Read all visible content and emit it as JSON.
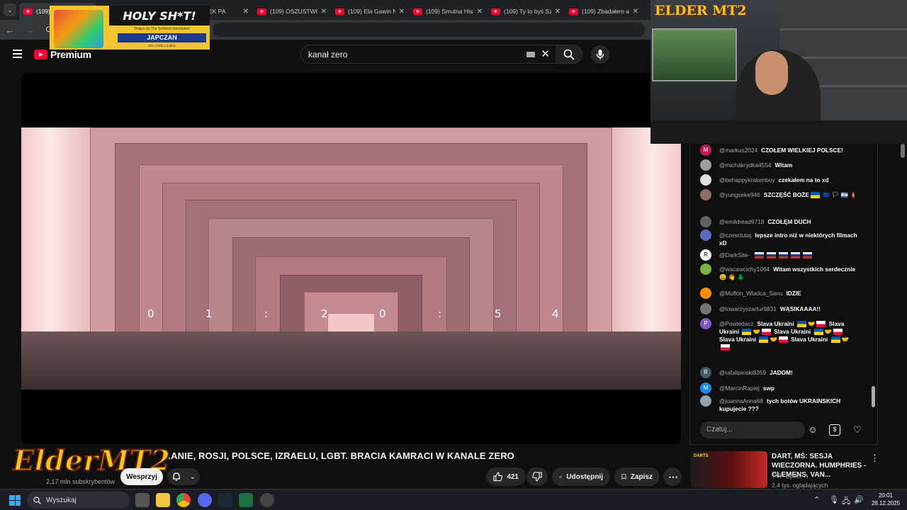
{
  "browser": {
    "tabs": [
      {
        "title": "(109) JASZCZ",
        "active": true
      },
      {
        "title": "(109) Ta...",
        "active": false
      },
      {
        "title": "UPADEK PA",
        "active": false
      },
      {
        "title": "(109) OSZUSTWO",
        "active": false
      },
      {
        "title": "(109) Ela Gawin N",
        "active": false
      },
      {
        "title": "(109) Smutna Hist",
        "active": false
      },
      {
        "title": "(109) Ty to byś Sz",
        "active": false
      },
      {
        "title": "(109) Zbadałem a",
        "active": false
      }
    ]
  },
  "promo": {
    "headline": "HOLY SH*T!",
    "tagline": "Dołącz do The Softdrink Revolution",
    "brand": "JAPCZAN",
    "discount": "10% zniżki z kodem"
  },
  "youtube": {
    "logo_text": "Premium",
    "search_value": "kanał zero",
    "player": {
      "timer_digits": [
        "0",
        "1",
        ":",
        "2",
        "0",
        ":",
        "5",
        "4"
      ]
    },
    "video_title": "...ANIE, ROSJI, POLSCE, IZRAELU, LGBT. BRACIA KAMRACI W KANALE ZERO",
    "channel_logo": "ElderMT2",
    "subscribers": "2,17 mln subskrybentów",
    "support_label": "Wesprzyj",
    "likes": "421",
    "share_label": "Udostępnij",
    "save_label": "Zapisz"
  },
  "webcam": {
    "overlay_logo": "ELDER MT2"
  },
  "chat": {
    "messages": [
      {
        "author": "@markus2024",
        "text": "CZOŁEM WIELKIEJ POLSCE!",
        "avatar": "M",
        "avatar_color": "#c2185b",
        "flags": []
      },
      {
        "author": "@michakrydka4554",
        "text": "Witam",
        "avatar": "",
        "avatar_color": "#9e9e9e",
        "flags": []
      },
      {
        "author": "@behappykrakenboy",
        "text": "czekałem na to xd",
        "avatar": "",
        "avatar_color": "#e0e0e0",
        "flags": []
      },
      {
        "author": "@yungseke946",
        "text": "SZCZĘŚĆ BOŻE",
        "avatar": "",
        "avatar_color": "#8d6e63",
        "flags": [
          "ua",
          "eu",
          "rainbow",
          "il",
          "extinguisher"
        ]
      },
      {
        "author": "@emildread9718",
        "text": "CZOŁĘM DUCH",
        "avatar": "",
        "avatar_color": "#616161",
        "flags": []
      },
      {
        "author": "@czesctutaj",
        "text": "lepsze intro niż w niektórych filmach xD",
        "avatar": "",
        "avatar_color": "#5c6bc0",
        "flags": []
      },
      {
        "author": "@DarkSite-",
        "text": "",
        "avatar": "R",
        "avatar_color": "#ffffff",
        "flags": [
          "ru",
          "ru",
          "ru",
          "ru",
          "ru"
        ]
      },
      {
        "author": "@wacawcichy1064",
        "text": "Witam wszystkich serdecznie",
        "avatar": "",
        "avatar_color": "#7cb342",
        "flags": [
          "smile",
          "wave",
          "tree"
        ]
      },
      {
        "author": "@Muflon_Wladca_Sanu",
        "text": "IDZIE",
        "avatar": "",
        "avatar_color": "#ff8f00",
        "flags": []
      },
      {
        "author": "@towarzyszartur9831",
        "text": "WĄSIKAAAA!!",
        "avatar": "",
        "avatar_color": "#757575",
        "flags": []
      },
      {
        "author": "@Powiedacz",
        "text": "Slava Ukraini",
        "avatar": "P",
        "avatar_color": "#7e57c2",
        "flags": []
      },
      {
        "author": "@rafalipinski8359",
        "text": "JADOM!",
        "avatar": "R",
        "avatar_color": "#455a64",
        "flags": []
      },
      {
        "author": "@MarcinRapiej",
        "text": "swp",
        "avatar": "M",
        "avatar_color": "#1e88e5",
        "flags": []
      },
      {
        "author": "@joannaAnna68",
        "text": "tych botów UKRAINSKICH kupujecie ???",
        "avatar": "",
        "avatar_color": "#90a4ae",
        "flags": []
      }
    ],
    "powiedacz_extra": "Slava Ukraini",
    "input_placeholder": "Czatuj..."
  },
  "recommendation": {
    "badge": "DARTS",
    "title": "DART, MŚ: SESJA WIECZORNA. HUMPHRIES - CLEMENS, VAN...",
    "channel": "TVP Sport",
    "views": "2,4 tys. oglądających"
  },
  "taskbar": {
    "search_label": "Wyszukaj",
    "time": "20:01",
    "date": "28.12.2025"
  }
}
